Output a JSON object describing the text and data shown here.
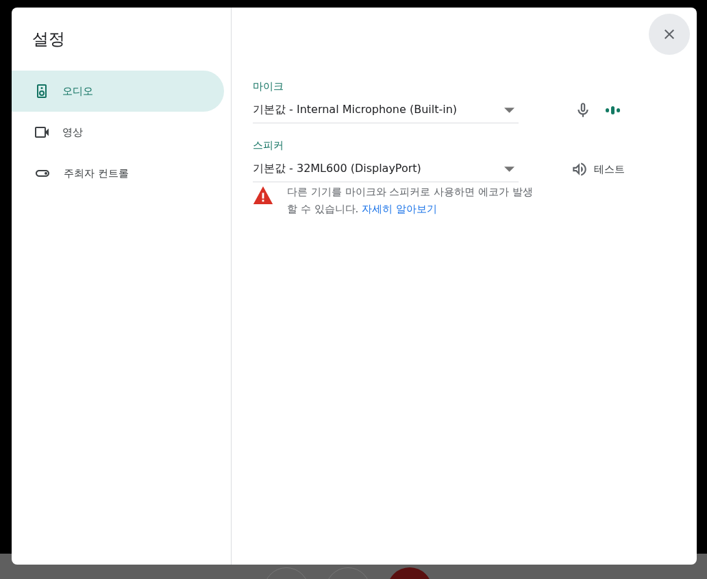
{
  "dialog": {
    "title": "설정",
    "nav": [
      {
        "label": "오디오",
        "selected": true
      },
      {
        "label": "영상",
        "selected": false
      },
      {
        "label": "주최자 컨트롤",
        "selected": false
      }
    ],
    "microphone": {
      "label": "마이크",
      "value": "기본값 - Internal Microphone (Built-in)"
    },
    "speaker": {
      "label": "스피커",
      "value": "기본값 - 32ML600 (DisplayPort)",
      "test_button": "테스트"
    },
    "warning": {
      "text": "다른 기기를 마이크와 스피커로 사용하면 에코가 발생할 수 있습니다.",
      "link": "자세히 알아보기"
    }
  }
}
